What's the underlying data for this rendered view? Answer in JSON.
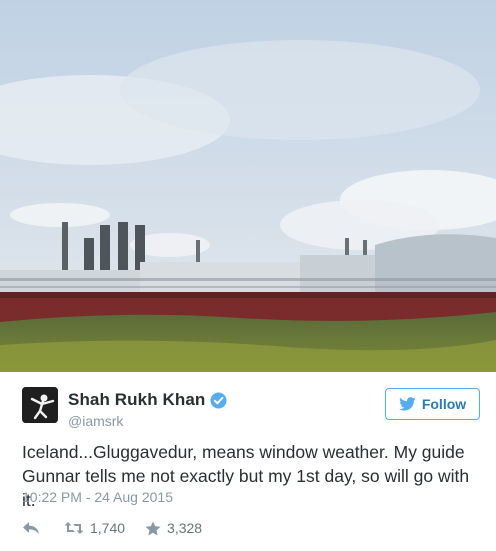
{
  "tweet": {
    "author": {
      "display_name": "Shah Rukh Khan",
      "handle": "@iamsrk",
      "verified": true,
      "avatar_icon": "avatar-photo"
    },
    "follow_label": "Follow",
    "text": "Iceland...Gluggavedur, means window weather. My guide Gunnar tells me not exactly but my 1st day, so will go with it.",
    "timestamp": "10:22 PM - 24 Aug 2015",
    "actions": {
      "reply_icon": "reply-icon",
      "retweet_icon": "retweet-icon",
      "retweet_count": "1,740",
      "favorite_icon": "star-icon",
      "favorite_count": "3,328"
    }
  },
  "colors": {
    "brand_blue": "#55acee",
    "follow_text": "#2b7bb9",
    "muted": "#8899a6",
    "text": "#292f33"
  }
}
